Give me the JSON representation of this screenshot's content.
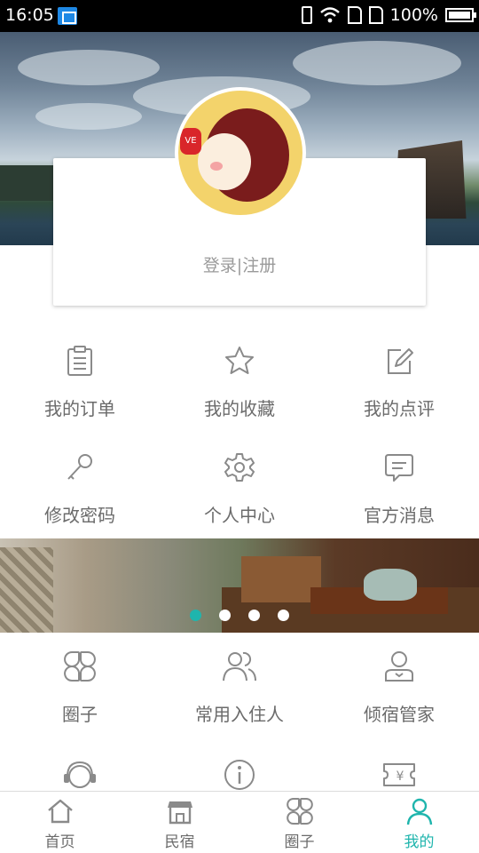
{
  "status_bar": {
    "time": "16:05",
    "battery": "100%"
  },
  "profile": {
    "login_label": "登录|注册"
  },
  "menu": [
    {
      "label": "我的订单",
      "icon": "clipboard-icon"
    },
    {
      "label": "我的收藏",
      "icon": "star-icon"
    },
    {
      "label": "我的点评",
      "icon": "edit-icon"
    },
    {
      "label": "修改密码",
      "icon": "key-icon"
    },
    {
      "label": "个人中心",
      "icon": "gear-icon"
    },
    {
      "label": "官方消息",
      "icon": "message-icon"
    }
  ],
  "carousel": {
    "slide_count": 4,
    "active_index": 0
  },
  "services": [
    {
      "label": "圈子",
      "icon": "circles-icon"
    },
    {
      "label": "常用入住人",
      "icon": "people-icon"
    },
    {
      "label": "倾宿管家",
      "icon": "butler-icon"
    },
    {
      "label": "",
      "icon": "headset-icon"
    },
    {
      "label": "",
      "icon": "info-icon"
    },
    {
      "label": "",
      "icon": "coupon-icon"
    }
  ],
  "tabs": [
    {
      "label": "首页",
      "icon": "home-icon",
      "active": false
    },
    {
      "label": "民宿",
      "icon": "shop-icon",
      "active": false
    },
    {
      "label": "圈子",
      "icon": "circles-icon",
      "active": false
    },
    {
      "label": "我的",
      "icon": "user-icon",
      "active": true
    }
  ],
  "colors": {
    "accent": "#1fb5ad",
    "icon_gray": "#8a8a8a",
    "text_gray": "#6b6b6b"
  }
}
